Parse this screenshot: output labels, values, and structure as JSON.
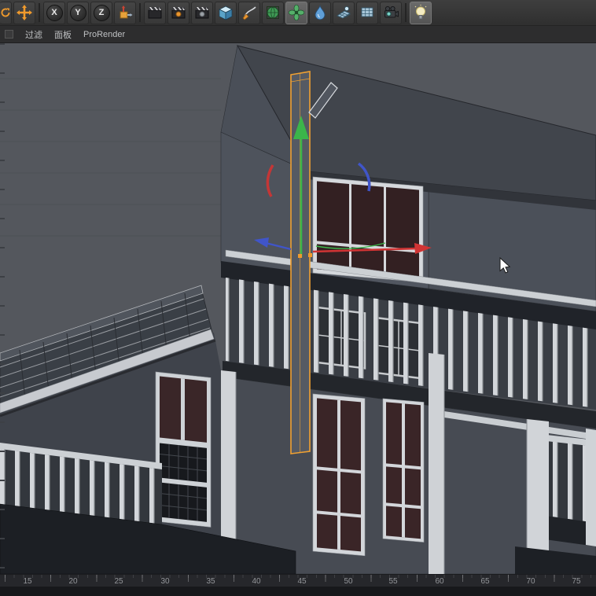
{
  "toolbar": {
    "buttons": [
      {
        "name": "rotate-tool"
      },
      {
        "name": "move-tool"
      },
      {
        "name": "axis-x-lock",
        "label": "X"
      },
      {
        "name": "axis-y-lock",
        "label": "Y"
      },
      {
        "name": "axis-z-lock",
        "label": "Z"
      },
      {
        "name": "coordinate-system"
      },
      {
        "name": "render-view"
      },
      {
        "name": "render-picture-viewer"
      },
      {
        "name": "render-settings"
      },
      {
        "name": "add-cube"
      },
      {
        "name": "spline-pen"
      },
      {
        "name": "subdivision-surface"
      },
      {
        "name": "mograph"
      },
      {
        "name": "deformer"
      },
      {
        "name": "floor"
      },
      {
        "name": "stage"
      },
      {
        "name": "camera"
      },
      {
        "name": "light"
      }
    ]
  },
  "menu": {
    "items": [
      {
        "label": "过滤"
      },
      {
        "label": "面板"
      },
      {
        "label": "ProRender"
      }
    ]
  },
  "ruler": {
    "values": [
      15,
      20,
      25,
      30,
      35,
      40,
      45,
      50,
      55,
      60,
      65,
      70,
      75
    ]
  },
  "viewport": {
    "background": "#54575d",
    "selection_color": "#f0a132",
    "axis_x_color": "#d03434",
    "axis_y_color": "#3bb54a",
    "axis_z_color": "#4055c9"
  }
}
